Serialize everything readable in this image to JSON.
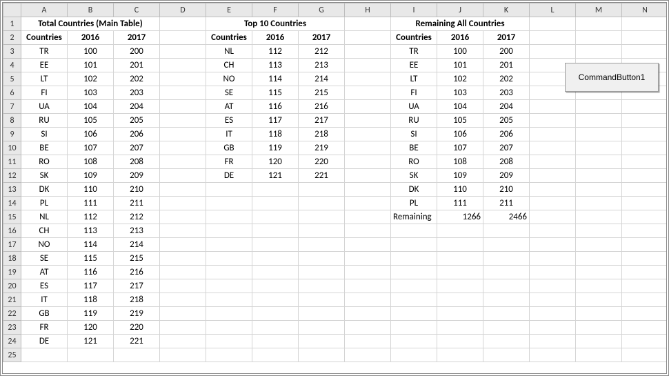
{
  "columns": [
    "A",
    "B",
    "C",
    "D",
    "E",
    "F",
    "G",
    "H",
    "I",
    "J",
    "K",
    "L",
    "M",
    "N"
  ],
  "row_count": 25,
  "titles": {
    "total": "Total Countries (Main Table)",
    "top10": "Top 10  Countries",
    "remaining_all": "Remaining All Countries"
  },
  "headers": {
    "countries": "Countries",
    "y1": "2016",
    "y2": "2017"
  },
  "total_table": [
    {
      "c": "TR",
      "v1": 100,
      "v2": 200
    },
    {
      "c": "EE",
      "v1": 101,
      "v2": 201
    },
    {
      "c": "LT",
      "v1": 102,
      "v2": 202
    },
    {
      "c": "FI",
      "v1": 103,
      "v2": 203
    },
    {
      "c": "UA",
      "v1": 104,
      "v2": 204
    },
    {
      "c": "RU",
      "v1": 105,
      "v2": 205
    },
    {
      "c": "SI",
      "v1": 106,
      "v2": 206
    },
    {
      "c": "BE",
      "v1": 107,
      "v2": 207
    },
    {
      "c": "RO",
      "v1": 108,
      "v2": 208
    },
    {
      "c": "SK",
      "v1": 109,
      "v2": 209
    },
    {
      "c": "DK",
      "v1": 110,
      "v2": 210
    },
    {
      "c": "PL",
      "v1": 111,
      "v2": 211
    },
    {
      "c": "NL",
      "v1": 112,
      "v2": 212
    },
    {
      "c": "CH",
      "v1": 113,
      "v2": 213
    },
    {
      "c": "NO",
      "v1": 114,
      "v2": 214
    },
    {
      "c": "SE",
      "v1": 115,
      "v2": 215
    },
    {
      "c": "AT",
      "v1": 116,
      "v2": 216
    },
    {
      "c": "ES",
      "v1": 117,
      "v2": 217
    },
    {
      "c": "IT",
      "v1": 118,
      "v2": 218
    },
    {
      "c": "GB",
      "v1": 119,
      "v2": 219
    },
    {
      "c": "FR",
      "v1": 120,
      "v2": 220
    },
    {
      "c": "DE",
      "v1": 121,
      "v2": 221
    }
  ],
  "top10_table": [
    {
      "c": "NL",
      "v1": 112,
      "v2": 212
    },
    {
      "c": "CH",
      "v1": 113,
      "v2": 213
    },
    {
      "c": "NO",
      "v1": 114,
      "v2": 214
    },
    {
      "c": "SE",
      "v1": 115,
      "v2": 215
    },
    {
      "c": "AT",
      "v1": 116,
      "v2": 216
    },
    {
      "c": "ES",
      "v1": 117,
      "v2": 217
    },
    {
      "c": "IT",
      "v1": 118,
      "v2": 218
    },
    {
      "c": "GB",
      "v1": 119,
      "v2": 219
    },
    {
      "c": "FR",
      "v1": 120,
      "v2": 220
    },
    {
      "c": "DE",
      "v1": 121,
      "v2": 221
    }
  ],
  "remaining_table": [
    {
      "c": "TR",
      "v1": 100,
      "v2": 200
    },
    {
      "c": "EE",
      "v1": 101,
      "v2": 201
    },
    {
      "c": "LT",
      "v1": 102,
      "v2": 202
    },
    {
      "c": "FI",
      "v1": 103,
      "v2": 203
    },
    {
      "c": "UA",
      "v1": 104,
      "v2": 204
    },
    {
      "c": "RU",
      "v1": 105,
      "v2": 205
    },
    {
      "c": "SI",
      "v1": 106,
      "v2": 206
    },
    {
      "c": "BE",
      "v1": 107,
      "v2": 207
    },
    {
      "c": "RO",
      "v1": 108,
      "v2": 208
    },
    {
      "c": "SK",
      "v1": 109,
      "v2": 209
    },
    {
      "c": "DK",
      "v1": 110,
      "v2": 210
    },
    {
      "c": "PL",
      "v1": 111,
      "v2": 211
    }
  ],
  "remaining_summary": {
    "label": "Remaining",
    "v1": 1266,
    "v2": 2466
  },
  "button": {
    "label": "CommandButton1"
  }
}
